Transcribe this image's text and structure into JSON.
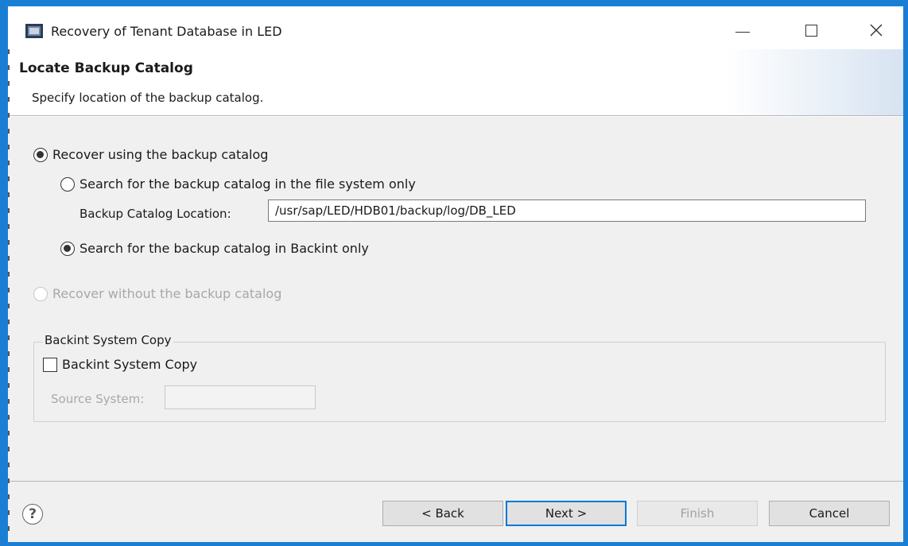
{
  "window": {
    "title": "Recovery of Tenant Database in LED",
    "icons": [
      "app-icon",
      "minimize-icon",
      "maximize-icon",
      "close-icon"
    ]
  },
  "header": {
    "title": "Locate Backup Catalog",
    "subtitle": "Specify location of the backup catalog."
  },
  "options": {
    "recover_using": {
      "label": "Recover using the backup catalog",
      "checked": true
    },
    "search_fs": {
      "label": "Search for the backup catalog in the file system only",
      "checked": false
    },
    "location_label": "Backup Catalog Location:",
    "location_value": "/usr/sap/LED/HDB01/backup/log/DB_LED",
    "search_backint": {
      "label": "Search for the backup catalog in Backint only",
      "checked": true
    },
    "recover_without": {
      "label": "Recover without the backup catalog",
      "checked": false,
      "disabled": true
    }
  },
  "backint_group": {
    "legend": "Backint System Copy",
    "checkbox_label": "Backint System Copy",
    "checked": false,
    "source_label": "Source System:",
    "source_value": ""
  },
  "footer": {
    "help_symbol": "?",
    "back_label": "< Back",
    "next_label": "Next >",
    "finish_label": "Finish",
    "cancel_label": "Cancel"
  },
  "colors": {
    "frame": "#1a7fd4",
    "focus": "#0078d7",
    "panel": "#f0f0f0",
    "disabled_text": "#a8a8a8"
  }
}
